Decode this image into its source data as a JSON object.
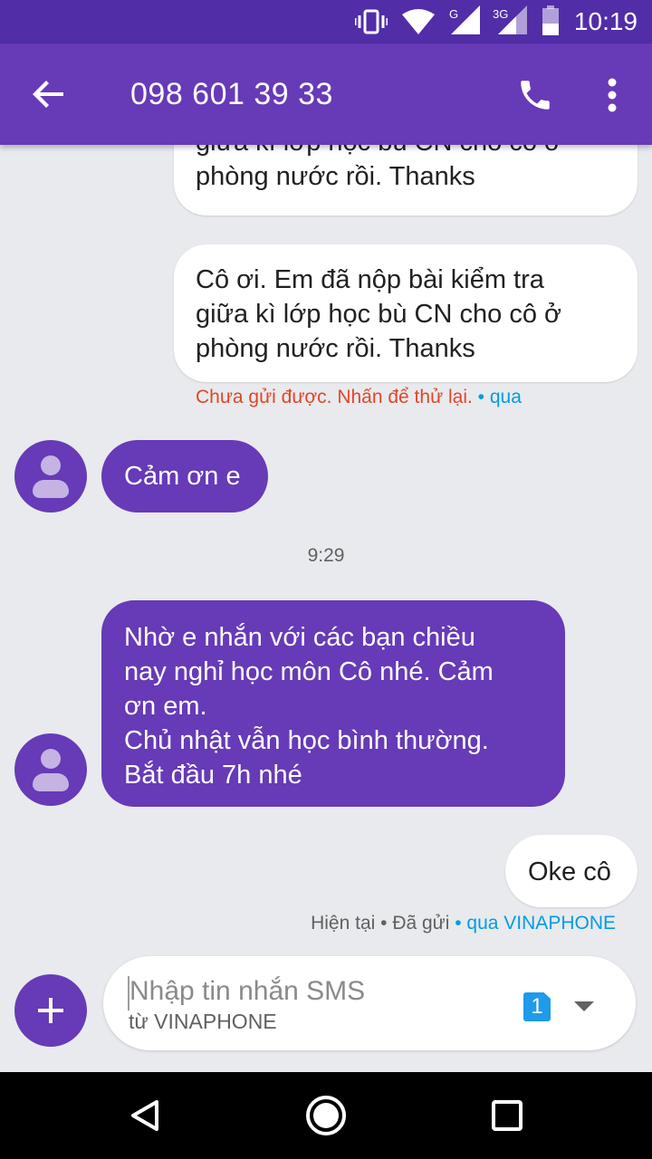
{
  "status_bar": {
    "time": "10:19",
    "network_g": "G",
    "network_3g": "3G",
    "icons": [
      "vibrate-icon",
      "wifi-icon",
      "signal-g-icon",
      "signal-3g-icon",
      "battery-icon"
    ]
  },
  "app_bar": {
    "title": "098 601 39 33",
    "icons": [
      "back-arrow-icon",
      "phone-call-icon",
      "more-vert-icon"
    ]
  },
  "messages": [
    {
      "direction": "outgoing",
      "text": "giữa kì lớp học bù CN cho cô ở\nphòng nước rồi. Thanks"
    },
    {
      "direction": "outgoing",
      "text": "Cô ơi. Em đã nộp bài kiểm tra\ngiữa kì lớp học bù CN cho cô ở\nphòng nước rồi. Thanks",
      "error": "Chưa gửi được. Nhấn để thử lại.",
      "via": " • qua"
    },
    {
      "direction": "incoming",
      "text": "Cảm ơn e"
    },
    {
      "direction": "incoming",
      "text": "Nhờ e nhắn với các bạn chiều\nnay nghỉ học môn Cô nhé. Cảm\nơn em.\nChủ nhật vẫn học bình thường.\nBắt đầu 7h nhé"
    },
    {
      "direction": "outgoing",
      "text": "Oke cô",
      "status": "Hiện tại • Đã gửi",
      "via": " • qua VINAPHONE"
    }
  ],
  "timestamp": "9:29",
  "compose": {
    "placeholder": "Nhập tin nhắn SMS",
    "sub": "từ VINAPHONE",
    "sim_slot": "1"
  },
  "nav_bar": {
    "icons": [
      "back-triangle-icon",
      "home-circle-icon",
      "recents-square-icon"
    ]
  }
}
